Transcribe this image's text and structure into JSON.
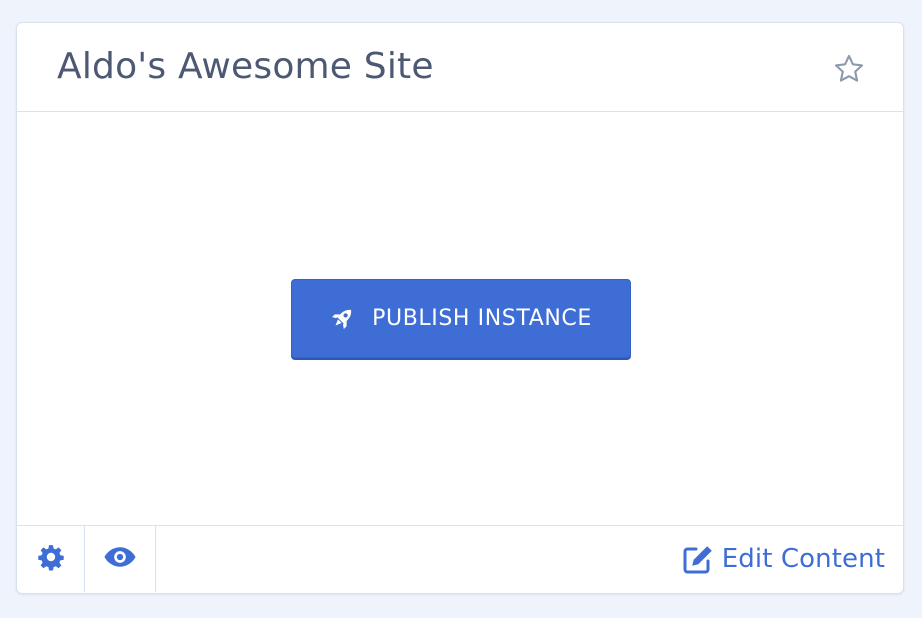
{
  "card": {
    "title": "Aldo's Awesome Site",
    "favorite_icon": "star-outline-icon"
  },
  "body": {
    "publish_button": {
      "icon": "rocket-icon",
      "label": "PUBLISH INSTANCE"
    }
  },
  "footer": {
    "settings_icon": "gear-icon",
    "preview_icon": "eye-icon",
    "edit_link": {
      "icon": "edit-icon",
      "label": "Edit Content"
    }
  },
  "colors": {
    "accent": "#3e6ed5",
    "title_text": "#4d5873",
    "border": "#d8e2f0",
    "page_background": "#eef3fc"
  }
}
